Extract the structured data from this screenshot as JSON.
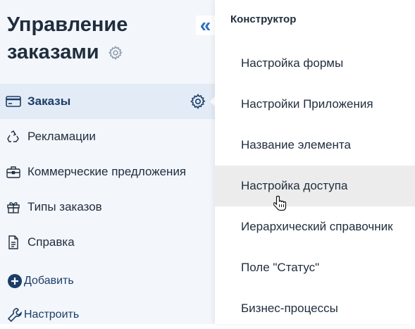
{
  "sidebar": {
    "title": "Управление заказами",
    "collapse_icon": "«",
    "items": [
      {
        "label": "Заказы",
        "icon": "card-icon",
        "active": true
      },
      {
        "label": "Рекламации",
        "icon": "recycle-icon"
      },
      {
        "label": "Коммерческие предложения",
        "icon": "briefcase-icon"
      },
      {
        "label": "Типы заказов",
        "icon": "gift-icon"
      },
      {
        "label": "Справка",
        "icon": "document-icon"
      }
    ],
    "actions": [
      {
        "label": "Добавить",
        "icon": "plus-circle-icon"
      },
      {
        "label": "Настроить",
        "icon": "wrench-icon"
      }
    ]
  },
  "menu": {
    "header": "Конструктор",
    "items": [
      {
        "label": "Настройка формы"
      },
      {
        "label": "Настройки Приложения"
      },
      {
        "label": "Название элемента"
      },
      {
        "label": "Настройка доступа",
        "hovered": true
      },
      {
        "label": "Иерархический справочник"
      },
      {
        "label": "Поле \"Статус\""
      },
      {
        "label": "Бизнес-процессы"
      }
    ]
  },
  "colors": {
    "sidebar_bg": "#f3f6fb",
    "active_bg": "#e3ebf6",
    "accent": "#1b3d68",
    "hover_bg": "#ececec"
  }
}
